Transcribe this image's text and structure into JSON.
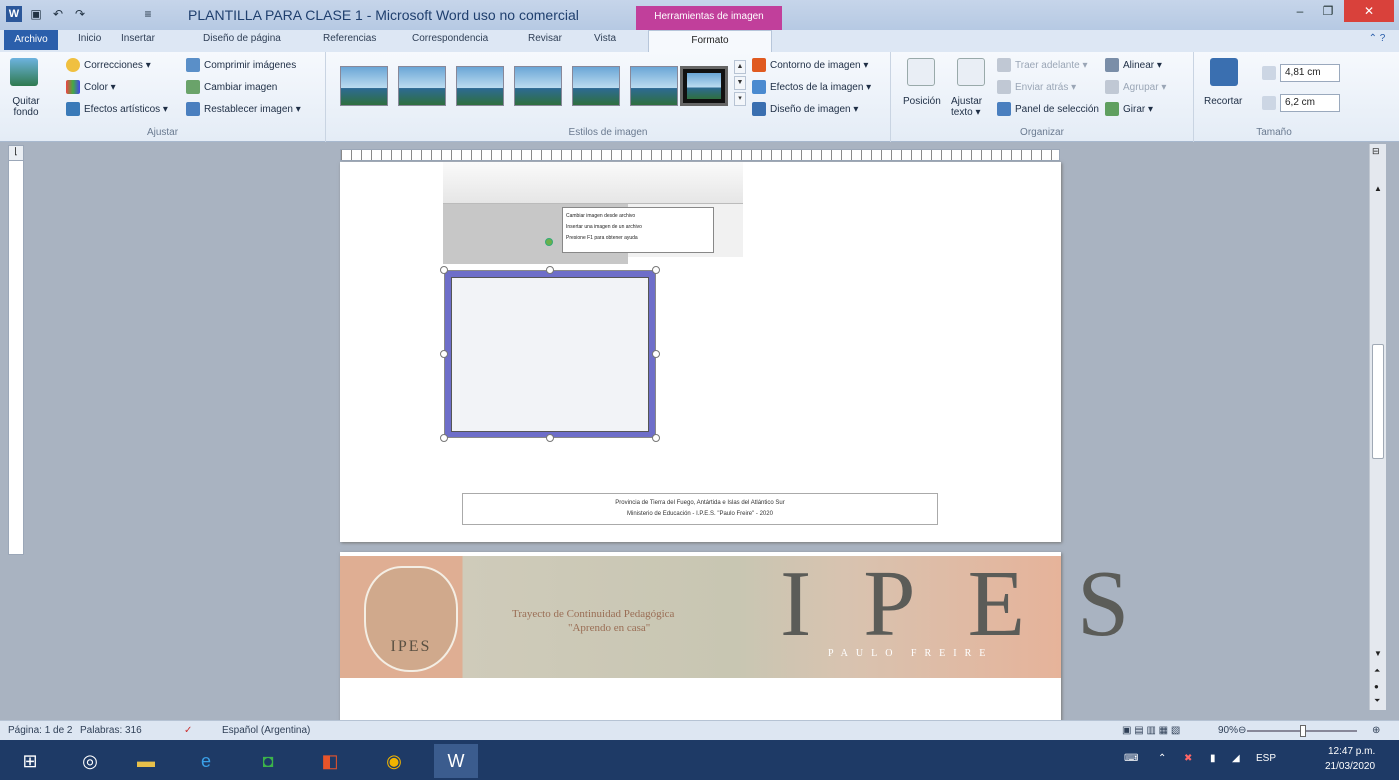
{
  "titlebar": {
    "title": "PLANTILLA PARA CLASE 1 - Microsoft Word uso no comercial",
    "contextual_tab": "Herramientas de imagen",
    "app_icon": "W"
  },
  "tabs": {
    "file": "Archivo",
    "items": [
      "Inicio",
      "Insertar",
      "Diseño de página",
      "Referencias",
      "Correspondencia",
      "Revisar",
      "Vista"
    ],
    "format": "Formato"
  },
  "ribbon": {
    "quitar_fondo": "Quitar fondo",
    "correcciones": "Correcciones ▾",
    "color": "Color ▾",
    "efectos_artisticos": "Efectos artísticos ▾",
    "comprimir": "Comprimir imágenes",
    "cambiar": "Cambiar imagen",
    "restablecer": "Restablecer imagen ▾",
    "ajustar_label": "Ajustar",
    "estilos_label": "Estilos de imagen",
    "contorno": "Contorno de imagen ▾",
    "efectos_imagen": "Efectos de la imagen ▾",
    "diseno_imagen": "Diseño de imagen ▾",
    "posicion": "Posición",
    "ajustar_texto": "Ajustar texto ▾",
    "traer_adelante": "Traer adelante ▾",
    "enviar_atras": "Enviar atrás ▾",
    "panel_seleccion": "Panel de selección",
    "alinear": "Alinear ▾",
    "agrupar": "Agrupar ▾",
    "girar": "Girar ▾",
    "organizar_label": "Organizar",
    "recortar": "Recortar",
    "alto": "4,81 cm",
    "ancho": "6,2 cm",
    "tamano_label": "Tamaño"
  },
  "document": {
    "inner_menu": [
      "Cambiar imagen desde archivo",
      "Insertar una imagen de un archivo",
      "Presione F1 para obtener ayuda"
    ],
    "footer_line1": "Provincia de Tierra del Fuego, Antártida e Islas del Atlántico Sur",
    "footer_line2": "Ministerio de Educación - I.P.E.S. \"Paulo Freire\" - 2020",
    "banner_title1": "Trayecto de Continuidad Pedagógica",
    "banner_title2": "\"Aprendo en casa\"",
    "banner_ipes": "IPES",
    "banner_sub": "PAULO FREIRE",
    "logo_text": "IPES"
  },
  "status": {
    "page": "Página: 1 de 2",
    "words": "Palabras: 316",
    "language": "Español (Argentina)",
    "zoom": "90%"
  },
  "taskbar": {
    "lang": "ESP",
    "time": "12:47 p.m.",
    "date": "21/03/2020"
  },
  "colors": {
    "accent": "#2b579a",
    "contextual": "#c13f9b",
    "taskbar": "#1e3a66"
  }
}
